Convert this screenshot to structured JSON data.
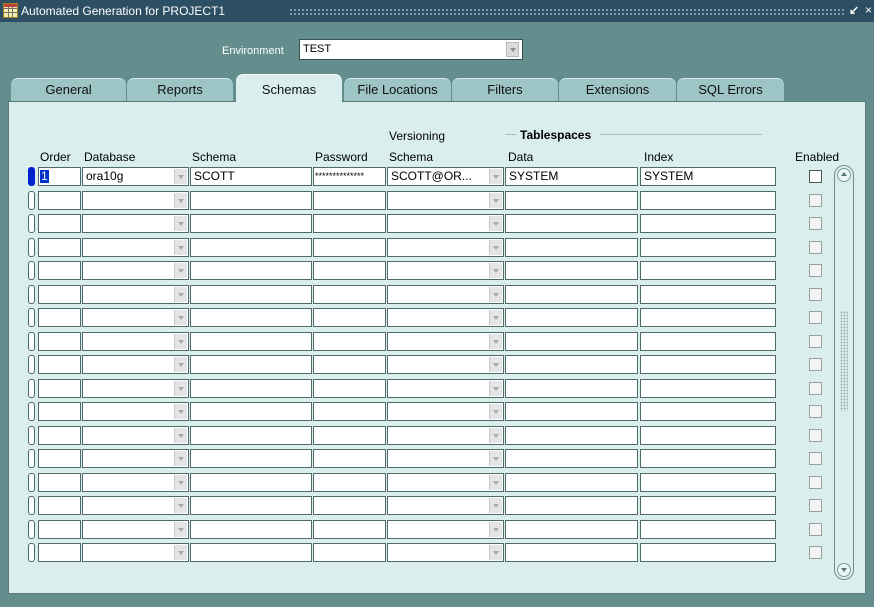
{
  "window": {
    "title": "Automated Generation for PROJECT1"
  },
  "environment": {
    "label": "Environment",
    "value": "TEST"
  },
  "tabs": [
    {
      "label": "General",
      "active": false
    },
    {
      "label": "Reports",
      "active": false
    },
    {
      "label": "Schemas",
      "active": true
    },
    {
      "label": "File Locations",
      "active": false
    },
    {
      "label": "Filters",
      "active": false
    },
    {
      "label": "Extensions",
      "active": false
    },
    {
      "label": "SQL Errors",
      "active": false
    }
  ],
  "grid": {
    "headers": {
      "order": "Order",
      "database": "Database",
      "schema": "Schema",
      "password": "Password",
      "versioning_top": "Versioning",
      "versioning_schema": "Schema",
      "tablespaces": "Tablespaces",
      "data": "Data",
      "index": "Index",
      "enabled": "Enabled"
    },
    "rows": [
      {
        "order": "1",
        "database": "ora10g",
        "schema": "SCOTT",
        "password": "**************",
        "versioning_schema": "SCOTT@OR...",
        "data": "SYSTEM",
        "index": "SYSTEM",
        "enabled": false,
        "current": true
      },
      {
        "order": "",
        "database": "",
        "schema": "",
        "password": "",
        "versioning_schema": "",
        "data": "",
        "index": "",
        "enabled": false,
        "current": false
      },
      {
        "order": "",
        "database": "",
        "schema": "",
        "password": "",
        "versioning_schema": "",
        "data": "",
        "index": "",
        "enabled": false,
        "current": false
      },
      {
        "order": "",
        "database": "",
        "schema": "",
        "password": "",
        "versioning_schema": "",
        "data": "",
        "index": "",
        "enabled": false,
        "current": false
      },
      {
        "order": "",
        "database": "",
        "schema": "",
        "password": "",
        "versioning_schema": "",
        "data": "",
        "index": "",
        "enabled": false,
        "current": false
      },
      {
        "order": "",
        "database": "",
        "schema": "",
        "password": "",
        "versioning_schema": "",
        "data": "",
        "index": "",
        "enabled": false,
        "current": false
      },
      {
        "order": "",
        "database": "",
        "schema": "",
        "password": "",
        "versioning_schema": "",
        "data": "",
        "index": "",
        "enabled": false,
        "current": false
      },
      {
        "order": "",
        "database": "",
        "schema": "",
        "password": "",
        "versioning_schema": "",
        "data": "",
        "index": "",
        "enabled": false,
        "current": false
      },
      {
        "order": "",
        "database": "",
        "schema": "",
        "password": "",
        "versioning_schema": "",
        "data": "",
        "index": "",
        "enabled": false,
        "current": false
      },
      {
        "order": "",
        "database": "",
        "schema": "",
        "password": "",
        "versioning_schema": "",
        "data": "",
        "index": "",
        "enabled": false,
        "current": false
      },
      {
        "order": "",
        "database": "",
        "schema": "",
        "password": "",
        "versioning_schema": "",
        "data": "",
        "index": "",
        "enabled": false,
        "current": false
      },
      {
        "order": "",
        "database": "",
        "schema": "",
        "password": "",
        "versioning_schema": "",
        "data": "",
        "index": "",
        "enabled": false,
        "current": false
      },
      {
        "order": "",
        "database": "",
        "schema": "",
        "password": "",
        "versioning_schema": "",
        "data": "",
        "index": "",
        "enabled": false,
        "current": false
      },
      {
        "order": "",
        "database": "",
        "schema": "",
        "password": "",
        "versioning_schema": "",
        "data": "",
        "index": "",
        "enabled": false,
        "current": false
      },
      {
        "order": "",
        "database": "",
        "schema": "",
        "password": "",
        "versioning_schema": "",
        "data": "",
        "index": "",
        "enabled": false,
        "current": false
      },
      {
        "order": "",
        "database": "",
        "schema": "",
        "password": "",
        "versioning_schema": "",
        "data": "",
        "index": "",
        "enabled": false,
        "current": false
      },
      {
        "order": "",
        "database": "",
        "schema": "",
        "password": "",
        "versioning_schema": "",
        "data": "",
        "index": "",
        "enabled": false,
        "current": false
      }
    ]
  },
  "icons": {
    "app": "grid-app-icon",
    "minimize": "minimize-icon",
    "close": "close-icon",
    "dropdown": "chevron-down-icon",
    "scroll_up": "scroll-up-icon",
    "scroll_down": "scroll-down-icon"
  },
  "colors": {
    "title_bar": "#2c4f63",
    "window_bg": "#648e8e",
    "panel_bg": "#dbeeee",
    "tab_inactive": "#9ec5c5",
    "selection": "#0033cc"
  }
}
